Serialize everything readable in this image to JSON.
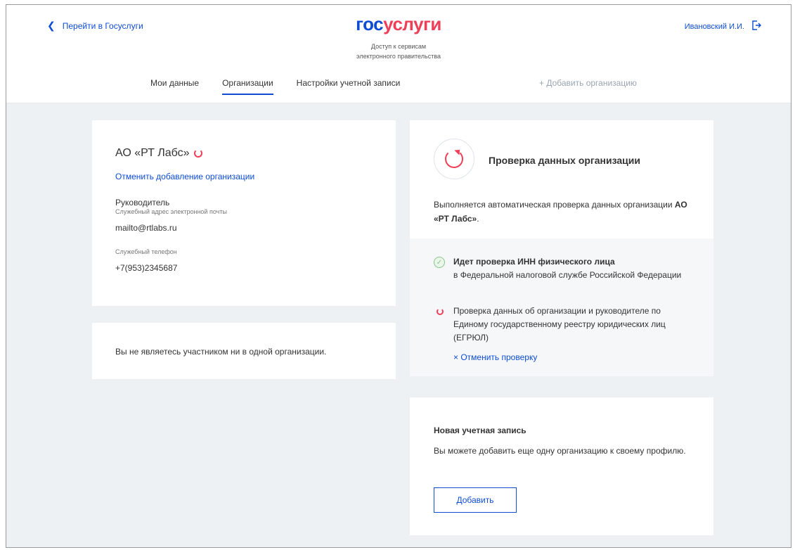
{
  "header": {
    "back_link": "Перейти в Госуслуги",
    "logo_part1": "гос",
    "logo_part2": "услуги",
    "subtitle_line1": "Доступ к сервисам",
    "subtitle_line2": "электронного правительства",
    "user_name": "Ивановский И.И.",
    "icons": {
      "back": "chevron-left-icon",
      "logout": "logout-icon"
    }
  },
  "tabs": [
    {
      "label": "Мои данные",
      "active": false
    },
    {
      "label": "Организации",
      "active": true
    },
    {
      "label": "Настройки учетной записи",
      "active": false
    }
  ],
  "add_org_link": "+ Добавить организацию",
  "org_card": {
    "name": "АО «РТ Лабс»",
    "cancel_link": "Отменить добавление организации",
    "role": "Руководитель",
    "email_label": "Служебный адрес электронной почты",
    "email": "mailto@rtlabs.ru",
    "phone_label": "Служебный телефон",
    "phone": "+7(953)2345687"
  },
  "no_membership_text": "Вы не являетесь участником ни в одной организации.",
  "check_card": {
    "title": "Проверка данных организации",
    "desc_prefix": "Выполняется автоматическая проверка данных организации",
    "desc_org": "АО «РТ Лабс»",
    "desc_suffix": ".",
    "steps": [
      {
        "status": "done",
        "title": "Идет проверка ИНН физического лица",
        "text": "в Федеральной налоговой службе Российской Федерации"
      },
      {
        "status": "in-progress",
        "title": "",
        "text": "Проверка данных об организации и руководителе по Единому государственному реестру юридических лиц (ЕГРЮЛ)"
      }
    ],
    "cancel_check": "× Отменить проверку"
  },
  "new_account_card": {
    "title": "Новая учетная запись",
    "desc": "Вы можете добавить еще одну организацию к своему профилю.",
    "button": "Добавить"
  },
  "colors": {
    "brand_blue": "#0d4cd3",
    "brand_red": "#ee3f58",
    "background": "#eef1f4",
    "success_green": "#8bc48a"
  }
}
